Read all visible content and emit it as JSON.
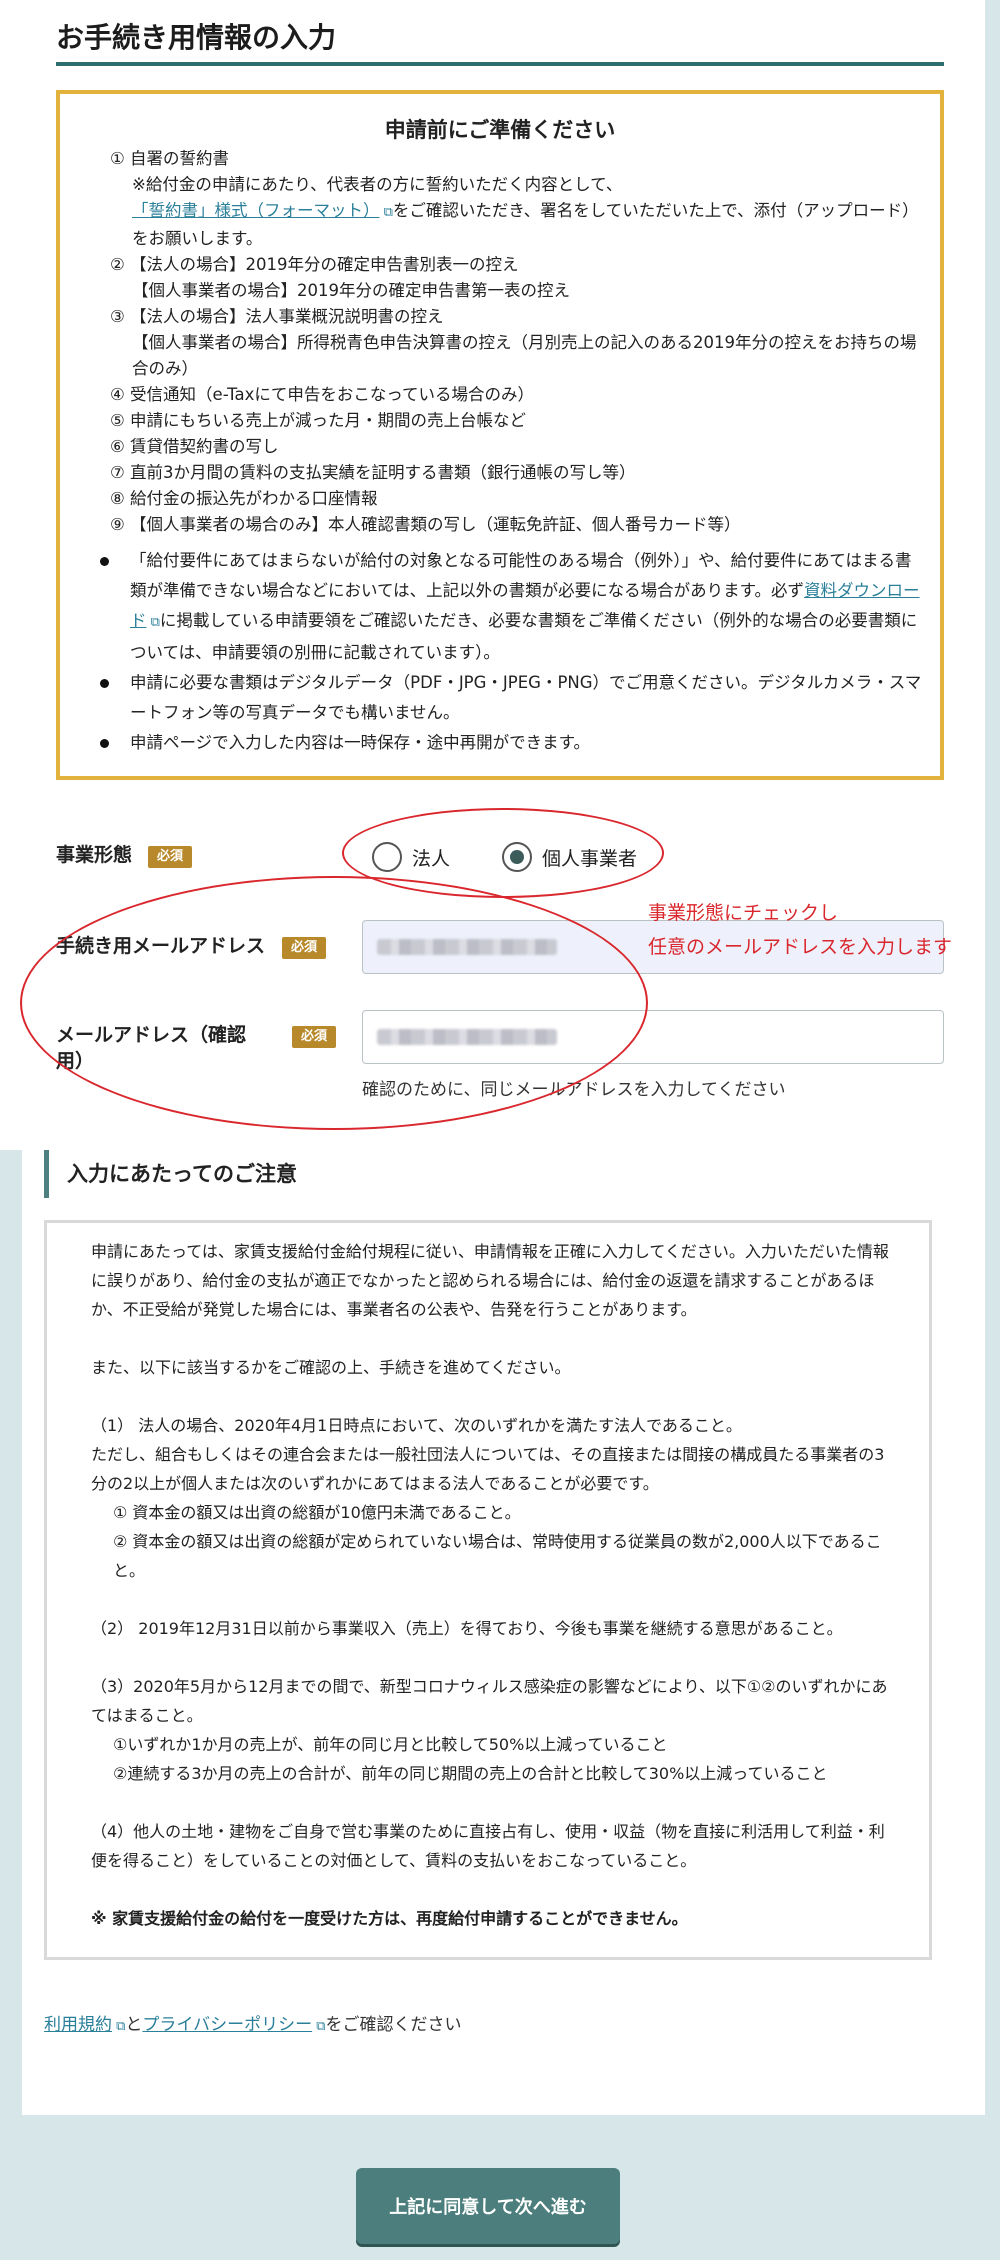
{
  "page": {
    "title": "お手続き用情報の入力"
  },
  "prep": {
    "heading": "申請前にご準備ください",
    "items": [
      {
        "text": "① 自署の誓約書",
        "sub": false
      },
      {
        "text": "※給付金の申請にあたり、代表者の方に誓約いただく内容として、",
        "sub": true
      },
      {
        "link": "「誓約書」様式（フォーマット）",
        "after": "をご確認いただき、署名をしていただいた上で、添付（アップロード）をお願いします。",
        "sub": true
      },
      {
        "text": "② 【法人の場合】2019年分の確定申告書別表一の控え",
        "sub": false
      },
      {
        "text": "【個人事業者の場合】2019年分の確定申告書第一表の控え",
        "sub": true
      },
      {
        "text": "③ 【法人の場合】法人事業概況説明書の控え",
        "sub": false
      },
      {
        "text": "【個人事業者の場合】所得税青色申告決算書の控え（月別売上の記入のある2019年分の控えをお持ちの場合のみ）",
        "sub": true
      },
      {
        "text": "④ 受信通知（e-Taxにて申告をおこなっている場合のみ）",
        "sub": false
      },
      {
        "text": "⑤ 申請にもちいる売上が減った月・期間の売上台帳など",
        "sub": false
      },
      {
        "text": "⑥ 賃貸借契約書の写し",
        "sub": false
      },
      {
        "text": "⑦ 直前3か月間の賃料の支払実績を証明する書類（銀行通帳の写し等）",
        "sub": false
      },
      {
        "text": "⑧ 給付金の振込先がわかる口座情報",
        "sub": false
      },
      {
        "text": "⑨ 【個人事業者の場合のみ】本人確認書類の写し（運転免許証、個人番号カード等）",
        "sub": false
      }
    ],
    "bullet1_before": "「給付要件にあてはまらないが給付の対象となる可能性のある場合（例外）」や、給付要件にあてはまる書類が準備できない場合などにおいては、上記以外の書類が必要になる場合があります。必ず",
    "bullet1_link": "資料ダウンロード",
    "bullet1_after": "に掲載している申請要領をご確認いただき、必要な書類をご準備ください（例外的な場合の必要書類については、申請要領の別冊に記載されています）。",
    "bullet2": "申請に必要な書類はデジタルデータ（PDF・JPG・JPEG・PNG）でご用意ください。デジタルカメラ・スマートフォン等の写真データでも構いません。",
    "bullet3": "申請ページで入力した内容は一時保存・途中再開ができます。"
  },
  "form": {
    "required_badge": "必須",
    "business_type": {
      "label": "事業形態",
      "options": [
        "法人",
        "個人事業者"
      ],
      "selected": "個人事業者"
    },
    "email": {
      "label": "手続き用メールアドレス"
    },
    "email_confirm": {
      "label": "メールアドレス（確認用）",
      "helper": "確認のために、同じメールアドレスを入力してください"
    }
  },
  "annotation": {
    "line1": "事業形態にチェックし",
    "line2": "任意のメールアドレスを入力します",
    "color": "#d9272d"
  },
  "notice": {
    "heading": "入力にあたってのご注意",
    "paragraphs": [
      "申請にあたっては、家賃支援給付金給付規程に従い、申請情報を正確に入力してください。入力いただいた情報に誤りがあり、給付金の支払が適正でなかったと認められる場合には、給付金の返還を請求することがあるほか、不正受給が発覚した場合には、事業者名の公表や、告発を行うことがあります。",
      "",
      "また、以下に該当するかをご確認の上、手続きを進めてください。",
      "",
      "（1） 法人の場合、2020年4月1日時点において、次のいずれかを満たす法人であること。",
      "ただし、組合もしくはその連合会または一般社団法人については、その直接または間接の構成員たる事業者の3分の2以上が個人または次のいずれかにあてはまる法人であることが必要です。",
      "① 資本金の額又は出資の総額が10億円未満であること。",
      "② 資本金の額又は出資の総額が定められていない場合は、常時使用する従業員の数が2,000人以下であること。",
      "",
      "（2） 2019年12月31日以前から事業収入（売上）を得ており、今後も事業を継続する意思があること。",
      "",
      "（3）2020年5月から12月までの間で、新型コロナウィルス感染症の影響などにより、以下①②のいずれかにあてはまること。",
      "①いずれか1か月の売上が、前年の同じ月と比較して50%以上減っていること",
      "②連続する3か月の売上の合計が、前年の同じ期間の売上の合計と比較して30%以上減っていること",
      "",
      "（4）他人の土地・建物をご自身で営む事業のために直接占有し、使用・収益（物を直接に利活用して利益・利便を得ること）をしていることの対価として、賃料の支払いをおこなっていること。",
      "",
      "※ 家賃支援給付金の給付を一度受けた方は、再度給付申請することができません。"
    ]
  },
  "footer": {
    "terms_link": "利用規約",
    "and": "と",
    "privacy_link": "プライバシーポリシー",
    "suffix": "をご確認ください"
  },
  "next_button": "上記に同意して次へ進む"
}
